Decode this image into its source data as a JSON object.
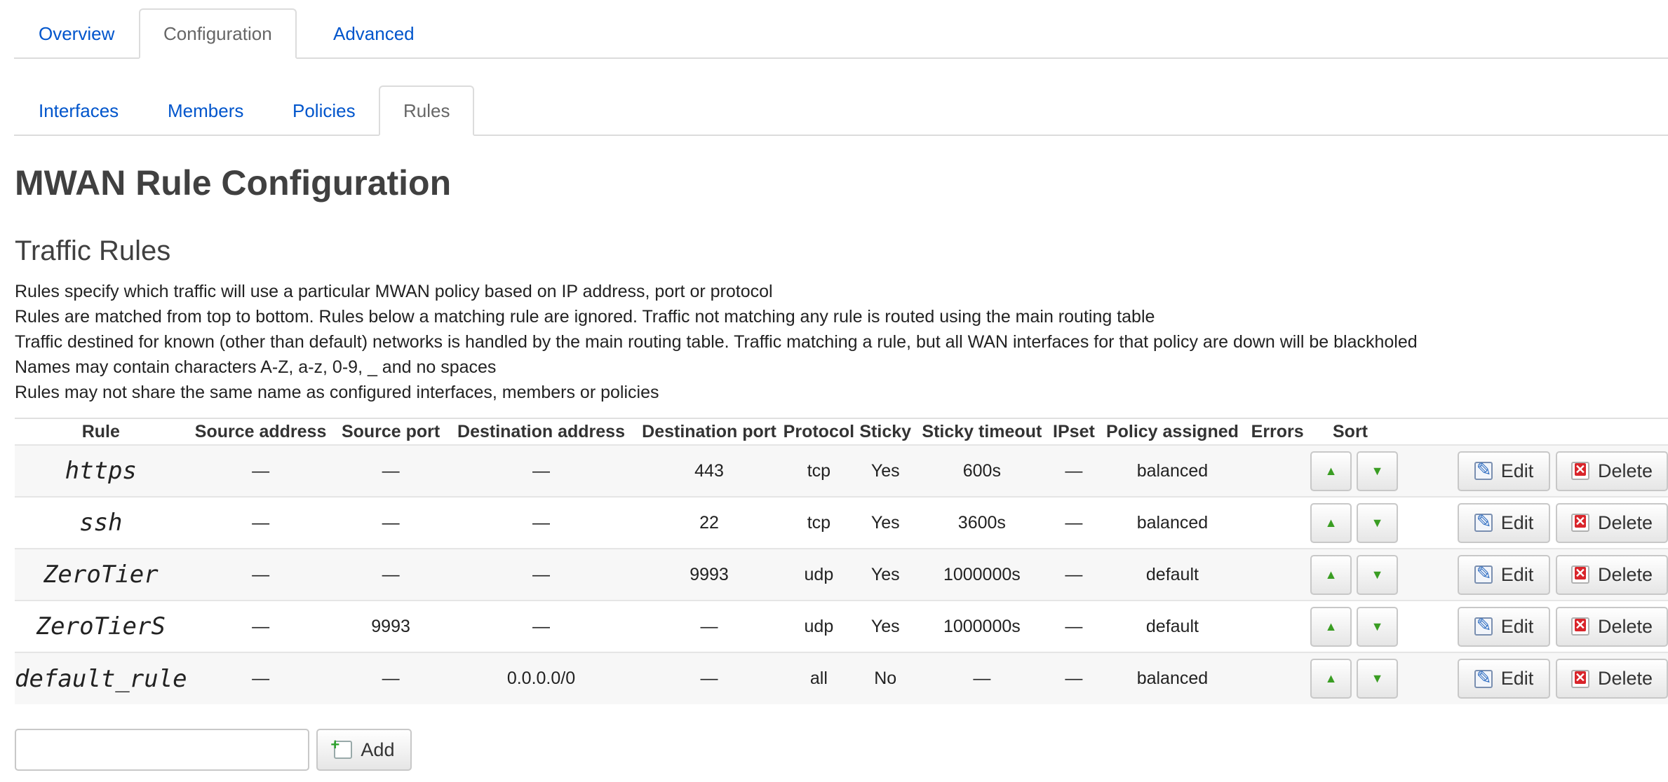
{
  "tabs_top": [
    {
      "label": "Overview",
      "active": false
    },
    {
      "label": "Configuration",
      "active": true
    },
    {
      "label": "Advanced",
      "active": false
    }
  ],
  "tabs_sub": [
    {
      "label": "Interfaces",
      "active": false
    },
    {
      "label": "Members",
      "active": false
    },
    {
      "label": "Policies",
      "active": false
    },
    {
      "label": "Rules",
      "active": true
    }
  ],
  "page_title": "MWAN Rule Configuration",
  "section_title": "Traffic Rules",
  "description": [
    "Rules specify which traffic will use a particular MWAN policy based on IP address, port or protocol",
    "Rules are matched from top to bottom. Rules below a matching rule are ignored. Traffic not matching any rule is routed using the main routing table",
    "Traffic destined for known (other than default) networks is handled by the main routing table. Traffic matching a rule, but all WAN interfaces for that policy are down will be blackholed",
    "Names may contain characters A-Z, a-z, 0-9, _ and no spaces",
    "Rules may not share the same name as configured interfaces, members or policies"
  ],
  "table": {
    "headers": [
      "Rule",
      "Source address",
      "Source port",
      "Destination address",
      "Destination port",
      "Protocol",
      "Sticky",
      "Sticky timeout",
      "IPset",
      "Policy assigned",
      "Errors",
      "Sort"
    ],
    "rows": [
      [
        "https",
        "—",
        "—",
        "—",
        "443",
        "tcp",
        "Yes",
        "600s",
        "—",
        "balanced",
        ""
      ],
      [
        "ssh",
        "—",
        "—",
        "—",
        "22",
        "tcp",
        "Yes",
        "3600s",
        "—",
        "balanced",
        ""
      ],
      [
        "ZeroTier",
        "—",
        "—",
        "—",
        "9993",
        "udp",
        "Yes",
        "1000000s",
        "—",
        "default",
        ""
      ],
      [
        "ZeroTierS",
        "—",
        "9993",
        "—",
        "—",
        "udp",
        "Yes",
        "1000000s",
        "—",
        "default",
        ""
      ],
      [
        "default_rule",
        "—",
        "—",
        "0.0.0.0/0",
        "—",
        "all",
        "No",
        "—",
        "—",
        "balanced",
        ""
      ]
    ],
    "edit_label": "Edit",
    "delete_label": "Delete"
  },
  "add": {
    "input_value": "",
    "button_label": "Add"
  },
  "icons": {
    "move_up": "arrow-up-icon",
    "move_down": "arrow-down-icon",
    "edit": "pencil-icon",
    "delete": "delete-x-icon",
    "add": "add-plus-icon"
  },
  "colors": {
    "link": "#0055cc",
    "arrow": "#3a9d23",
    "delete": "#d9252b"
  }
}
